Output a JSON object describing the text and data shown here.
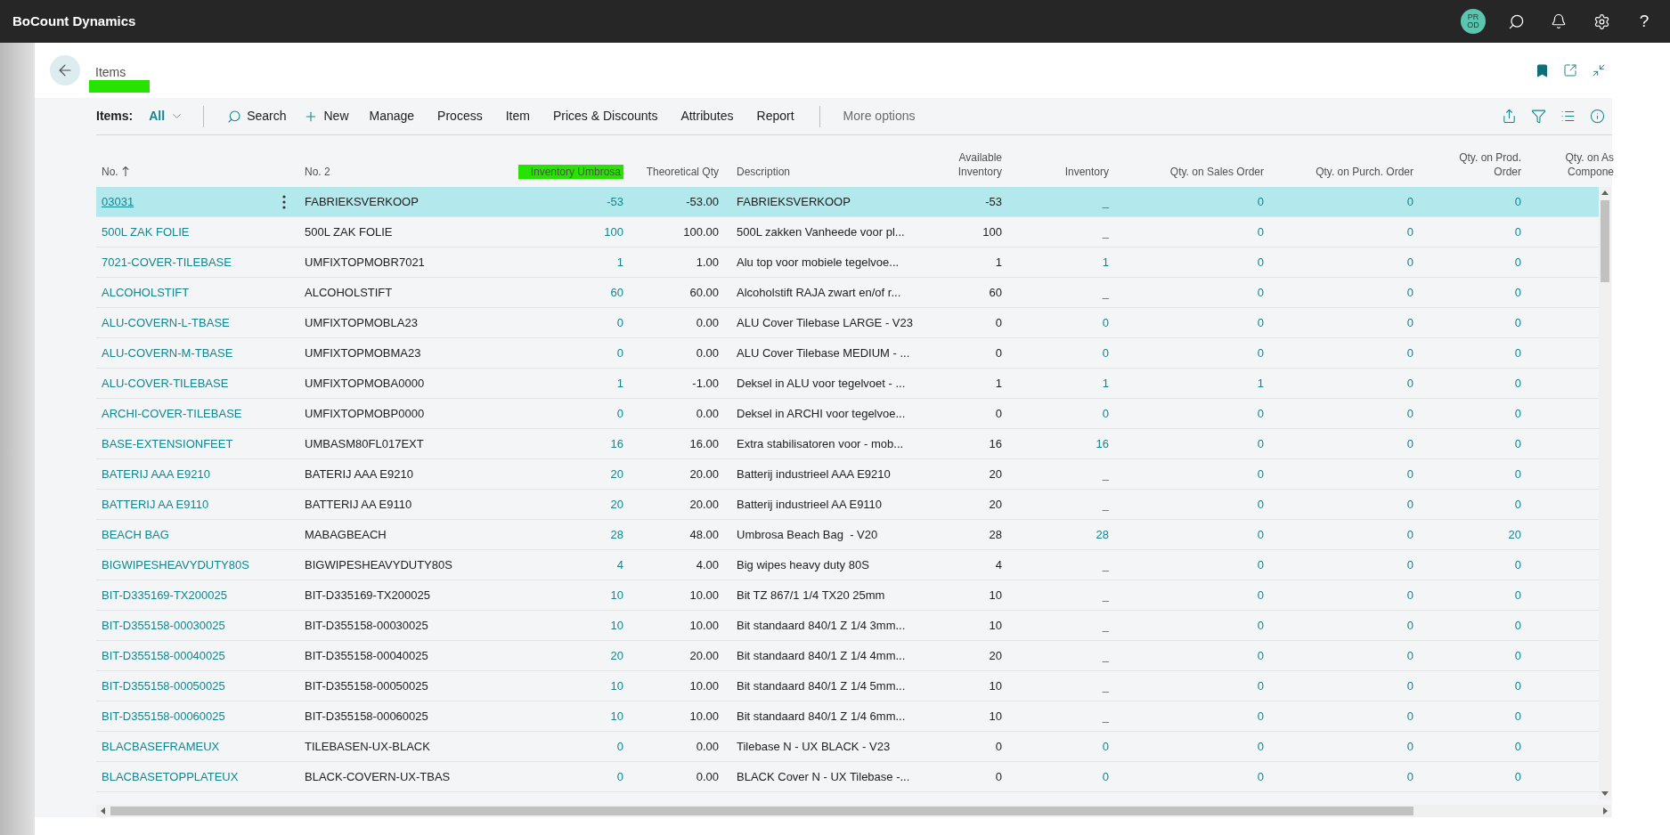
{
  "app_bar": {
    "title": "BoCount Dynamics",
    "environment": "PROD",
    "help": "?"
  },
  "page": {
    "title": "Items",
    "highlighted": true
  },
  "toolbar": {
    "filter_label": "Items:",
    "view": "All",
    "actions": [
      {
        "label": "Search",
        "kind": "search"
      },
      {
        "label": "New",
        "kind": "new"
      },
      {
        "label": "Manage",
        "kind": "menu"
      },
      {
        "label": "Process",
        "kind": "menu"
      },
      {
        "label": "Item",
        "kind": "menu"
      },
      {
        "label": "Prices & Discounts",
        "kind": "menu"
      },
      {
        "label": "Attributes",
        "kind": "menu"
      },
      {
        "label": "Report",
        "kind": "menu"
      }
    ],
    "more_options": "More options"
  },
  "table": {
    "columns": [
      {
        "label": "No.",
        "kind": "link",
        "sorted": true,
        "highlighted": false
      },
      {
        "label": "No. 2",
        "kind": "text",
        "sorted": false,
        "highlighted": false
      },
      {
        "label": "Inventory Umbrosa",
        "kind": "drilldown",
        "sorted": false,
        "highlighted": true
      },
      {
        "label": "Theoretical Qty",
        "kind": "number",
        "sorted": false,
        "highlighted": false
      },
      {
        "label": "Description",
        "kind": "text",
        "sorted": false,
        "highlighted": false
      },
      {
        "label": "Available Inventory",
        "kind": "number",
        "sorted": false,
        "highlighted": false
      },
      {
        "label": "Inventory",
        "kind": "drilldown",
        "sorted": false,
        "highlighted": false
      },
      {
        "label": "Qty. on Sales Order",
        "kind": "drilldown",
        "sorted": false,
        "highlighted": false
      },
      {
        "label": "Qty. on Purch. Order",
        "kind": "drilldown",
        "sorted": false,
        "highlighted": false
      },
      {
        "label": "Qty. on Prod. Order",
        "kind": "drilldown",
        "sorted": false,
        "highlighted": false
      },
      {
        "label": "Qty. on As Compone",
        "kind": "drilldown",
        "sorted": false,
        "highlighted": false
      }
    ],
    "rows": [
      {
        "selected": true,
        "cells": [
          "03031",
          "FABRIEKSVERKOOP",
          "-53",
          "-53.00",
          "FABRIEKSVERKOOP",
          "-53",
          "_",
          "0",
          "0",
          "0"
        ]
      },
      {
        "selected": false,
        "cells": [
          "500L ZAK FOLIE",
          "500L ZAK FOLIE",
          "100",
          "100.00",
          "500L zakken Vanheede voor pl...",
          "100",
          "_",
          "0",
          "0",
          "0"
        ]
      },
      {
        "selected": false,
        "cells": [
          "7021-COVER-TILEBASE",
          "UMFIXTOPMOBR7021",
          "1",
          "1.00",
          "Alu top voor mobiele tegelvoe...",
          "1",
          "1",
          "0",
          "0",
          "0"
        ]
      },
      {
        "selected": false,
        "cells": [
          "ALCOHOLSTIFT",
          "ALCOHOLSTIFT",
          "60",
          "60.00",
          "Alcoholstift RAJA zwart en/of r...",
          "60",
          "_",
          "0",
          "0",
          "0"
        ]
      },
      {
        "selected": false,
        "cells": [
          "ALU-COVERN-L-TBASE",
          "UMFIXTOPMOBLA23",
          "0",
          "0.00",
          "ALU Cover Tilebase LARGE - V23",
          "0",
          "0",
          "0",
          "0",
          "0"
        ]
      },
      {
        "selected": false,
        "cells": [
          "ALU-COVERN-M-TBASE",
          "UMFIXTOPMOBMA23",
          "0",
          "0.00",
          "ALU Cover Tilebase MEDIUM - ...",
          "0",
          "0",
          "0",
          "0",
          "0"
        ]
      },
      {
        "selected": false,
        "cells": [
          "ALU-COVER-TILEBASE",
          "UMFIXTOPMOBA0000",
          "1",
          "-1.00",
          "Deksel in ALU voor tegelvoet - ...",
          "1",
          "1",
          "1",
          "0",
          "0"
        ]
      },
      {
        "selected": false,
        "cells": [
          "ARCHI-COVER-TILEBASE",
          "UMFIXTOPMOBP0000",
          "0",
          "0.00",
          "Deksel in ARCHI voor tegelvoe...",
          "0",
          "0",
          "0",
          "0",
          "0"
        ]
      },
      {
        "selected": false,
        "cells": [
          "BASE-EXTENSIONFEET",
          "UMBASM80FL017EXT",
          "16",
          "16.00",
          "Extra stabilisatoren voor - mob...",
          "16",
          "16",
          "0",
          "0",
          "0"
        ]
      },
      {
        "selected": false,
        "cells": [
          "BATERIJ AAA E9210",
          "BATERIJ AAA E9210",
          "20",
          "20.00",
          "Batterij industrieel AAA E9210",
          "20",
          "_",
          "0",
          "0",
          "0"
        ]
      },
      {
        "selected": false,
        "cells": [
          "BATTERIJ AA E9110",
          "BATTERIJ AA E9110",
          "20",
          "20.00",
          "Batterij industrieel AA E9110",
          "20",
          "_",
          "0",
          "0",
          "0"
        ]
      },
      {
        "selected": false,
        "cells": [
          "BEACH BAG",
          "MABAGBEACH",
          "28",
          "48.00",
          "Umbrosa Beach Bag  - V20",
          "28",
          "28",
          "0",
          "0",
          "20"
        ]
      },
      {
        "selected": false,
        "cells": [
          "BIGWIPESHEAVYDUTY80S",
          "BIGWIPESHEAVYDUTY80S",
          "4",
          "4.00",
          "Big wipes heavy duty 80S",
          "4",
          "_",
          "0",
          "0",
          "0"
        ]
      },
      {
        "selected": false,
        "cells": [
          "BIT-D335169-TX200025",
          "BIT-D335169-TX200025",
          "10",
          "10.00",
          "Bit TZ 867/1 1/4 TX20 25mm",
          "10",
          "_",
          "0",
          "0",
          "0"
        ]
      },
      {
        "selected": false,
        "cells": [
          "BIT-D355158-00030025",
          "BIT-D355158-00030025",
          "10",
          "10.00",
          "Bit standaard 840/1 Z 1/4 3mm...",
          "10",
          "_",
          "0",
          "0",
          "0"
        ]
      },
      {
        "selected": false,
        "cells": [
          "BIT-D355158-00040025",
          "BIT-D355158-00040025",
          "20",
          "20.00",
          "Bit standaard 840/1 Z 1/4 4mm...",
          "20",
          "_",
          "0",
          "0",
          "0"
        ]
      },
      {
        "selected": false,
        "cells": [
          "BIT-D355158-00050025",
          "BIT-D355158-00050025",
          "10",
          "10.00",
          "Bit standaard 840/1 Z 1/4 5mm...",
          "10",
          "_",
          "0",
          "0",
          "0"
        ]
      },
      {
        "selected": false,
        "cells": [
          "BIT-D355158-00060025",
          "BIT-D355158-00060025",
          "10",
          "10.00",
          "Bit standaard 840/1 Z 1/4 6mm...",
          "10",
          "_",
          "0",
          "0",
          "0"
        ]
      },
      {
        "selected": false,
        "cells": [
          "BLACBASEFRAMEUX",
          "TILEBASEN-UX-BLACK",
          "0",
          "0.00",
          "Tilebase N - UX BLACK - V23",
          "0",
          "0",
          "0",
          "0",
          "0"
        ]
      },
      {
        "selected": false,
        "cells": [
          "BLACBASETOPPLATEUX",
          "BLACK-COVERN-UX-TBAS",
          "0",
          "0.00",
          "BLACK Cover N - UX Tilebase -...",
          "0",
          "0",
          "0",
          "0",
          "0"
        ]
      }
    ]
  }
}
